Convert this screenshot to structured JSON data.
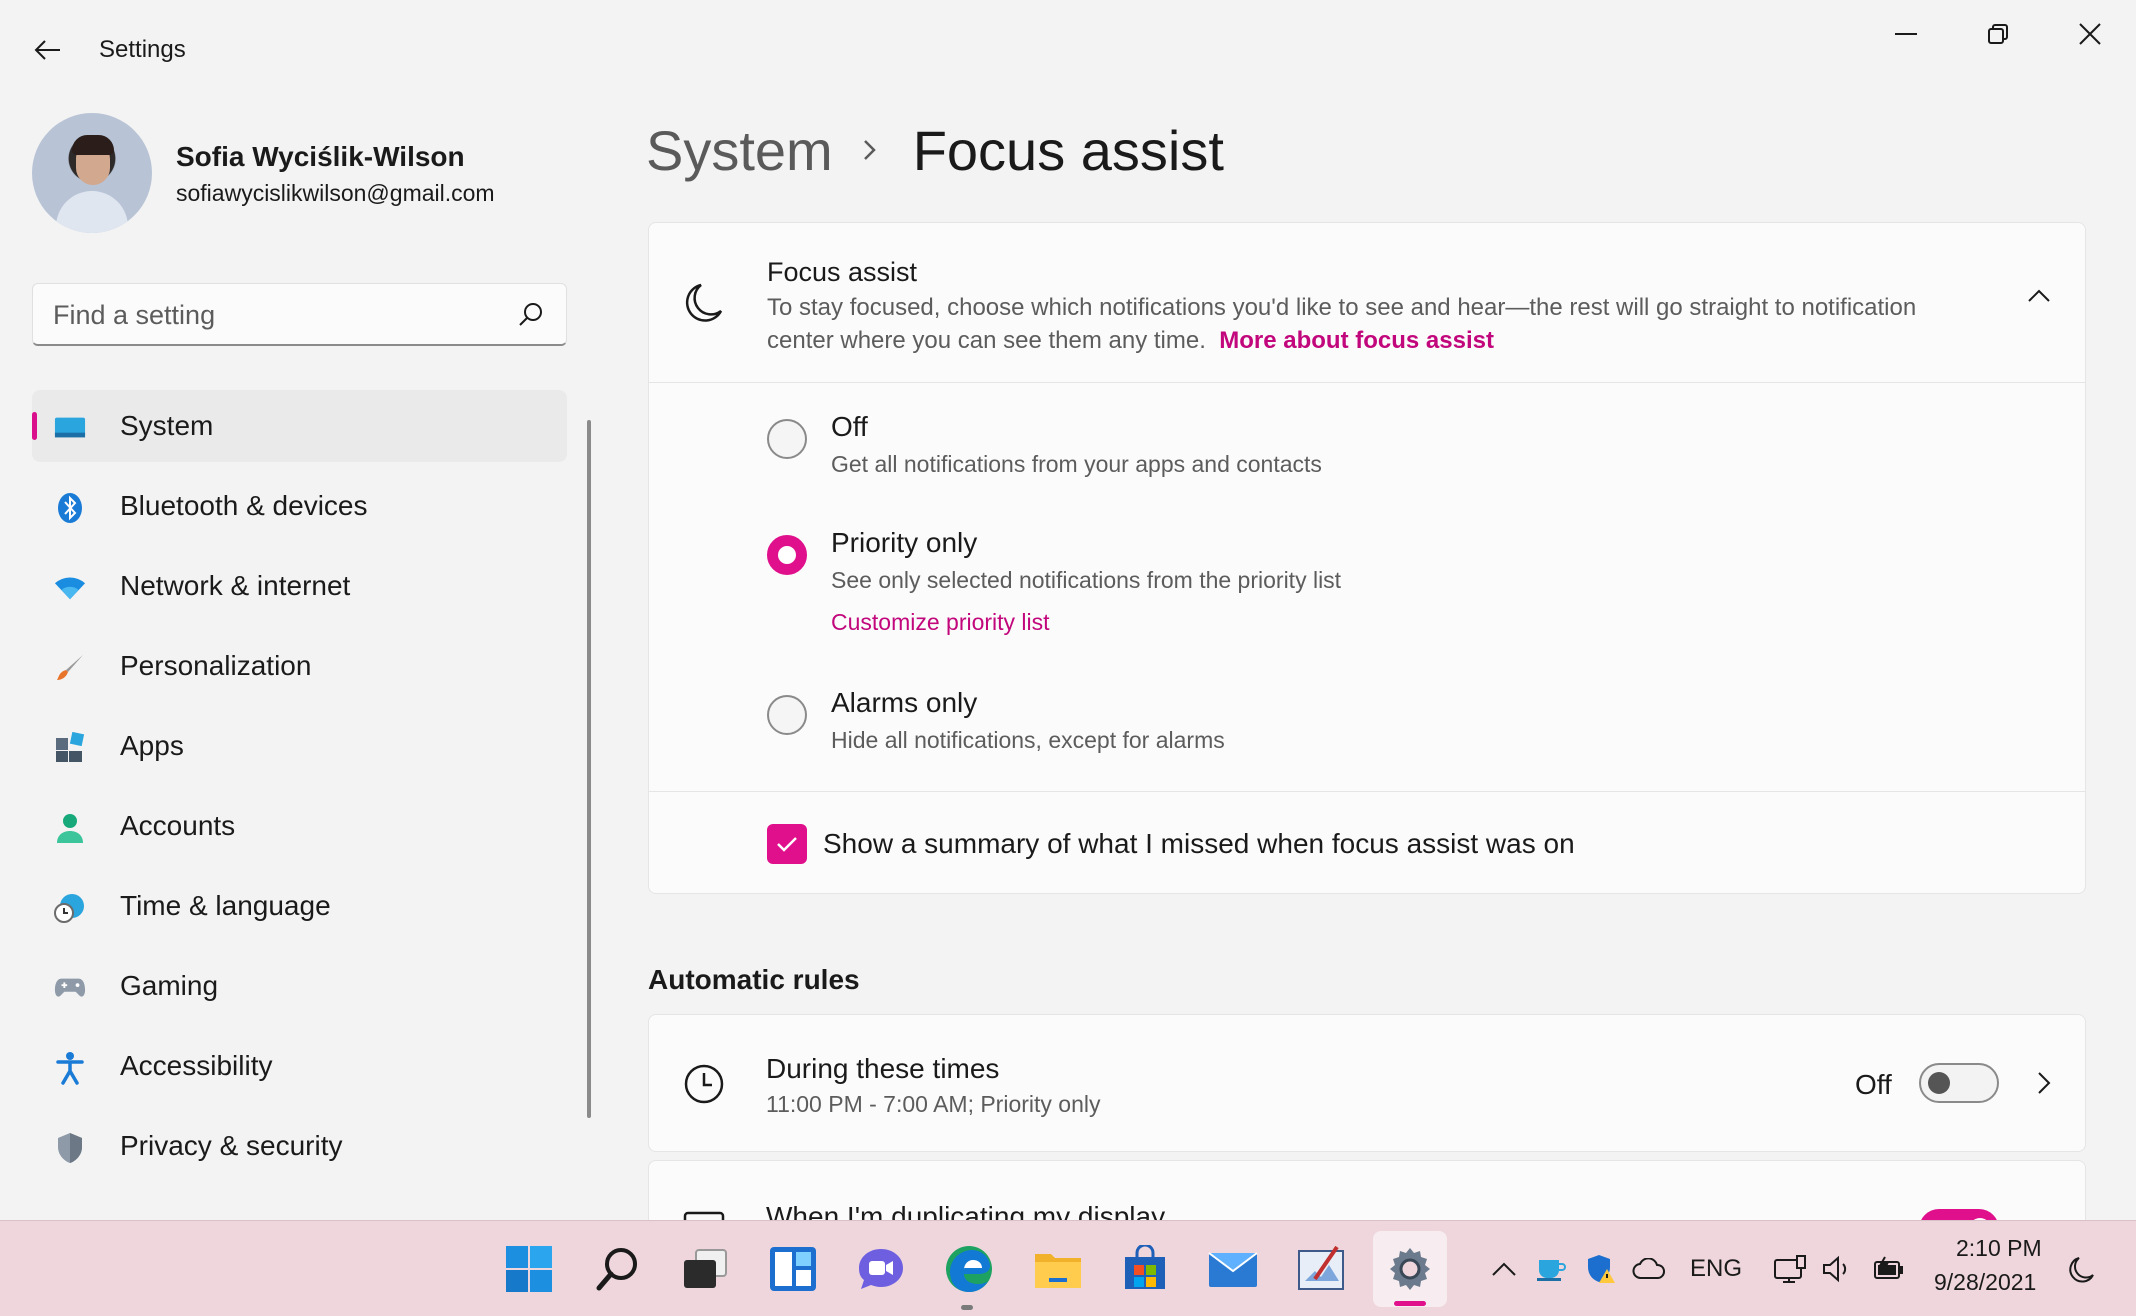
{
  "window": {
    "title": "Settings"
  },
  "colors": {
    "accent": "#e0108c",
    "link": "#c2077c",
    "taskbar": "#eed6dc"
  },
  "profile": {
    "name": "Sofia Wyciślik-Wilson",
    "email": "sofiawycislikwilson@gmail.com"
  },
  "search": {
    "placeholder": "Find a setting"
  },
  "sidebar": {
    "items": [
      {
        "label": "System",
        "icon": "system-icon",
        "active": true
      },
      {
        "label": "Bluetooth & devices",
        "icon": "bluetooth-icon"
      },
      {
        "label": "Network & internet",
        "icon": "wifi-icon"
      },
      {
        "label": "Personalization",
        "icon": "brush-icon"
      },
      {
        "label": "Apps",
        "icon": "apps-icon"
      },
      {
        "label": "Accounts",
        "icon": "person-icon"
      },
      {
        "label": "Time & language",
        "icon": "globe-clock-icon"
      },
      {
        "label": "Gaming",
        "icon": "gamepad-icon"
      },
      {
        "label": "Accessibility",
        "icon": "accessibility-icon"
      },
      {
        "label": "Privacy & security",
        "icon": "shield-icon"
      }
    ]
  },
  "breadcrumb": {
    "parent": "System",
    "current": "Focus assist"
  },
  "focus_assist": {
    "title": "Focus assist",
    "description": "To stay focused, choose which notifications you'd like to see and hear—the rest will go straight to notification center where you can see them any time.",
    "link": "More about focus assist",
    "options": [
      {
        "label": "Off",
        "description": "Get all notifications from your apps and contacts",
        "checked": false
      },
      {
        "label": "Priority only",
        "description": "See only selected notifications from the priority list",
        "link": "Customize priority list",
        "checked": true
      },
      {
        "label": "Alarms only",
        "description": "Hide all notifications, except for alarms",
        "checked": false
      }
    ],
    "summary": {
      "label": "Show a summary of what I missed when focus assist was on",
      "checked": true
    }
  },
  "automatic_rules": {
    "title": "Automatic rules",
    "rules": [
      {
        "title": "During these times",
        "subtitle": "11:00 PM - 7:00 AM; Priority only",
        "state_label": "Off",
        "on": false
      },
      {
        "title": "When I'm duplicating my display",
        "on": true
      }
    ]
  },
  "taskbar": {
    "apps": [
      "windows-start-icon",
      "search-icon",
      "task-view-icon",
      "widgets-icon",
      "chat-icon",
      "edge-icon",
      "file-explorer-icon",
      "store-icon",
      "mail-icon",
      "paint-icon",
      "settings-icon"
    ],
    "language": "ENG",
    "time": "2:10 PM",
    "date": "9/28/2021"
  }
}
